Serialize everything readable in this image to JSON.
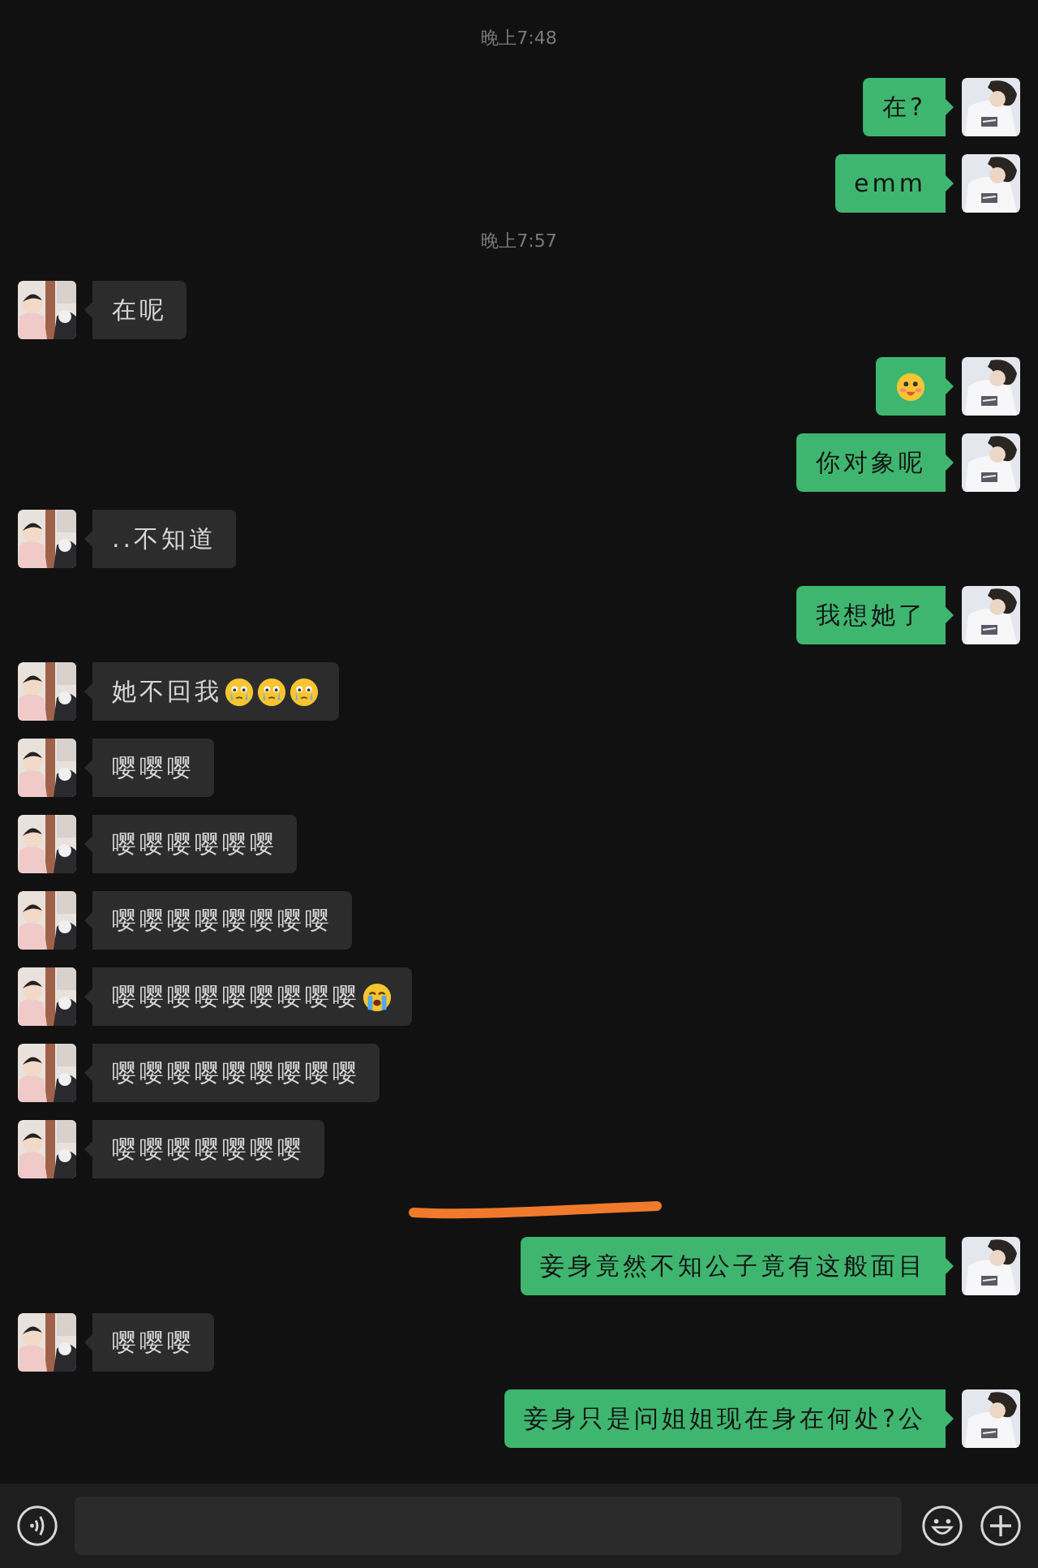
{
  "messages": [
    {
      "kind": "time",
      "text": "晚上7:48"
    },
    {
      "kind": "sent",
      "parts": [
        {
          "kind": "text",
          "text": "在?"
        }
      ]
    },
    {
      "kind": "sent",
      "parts": [
        {
          "kind": "text",
          "text": "emm"
        }
      ]
    },
    {
      "kind": "time",
      "text": "晚上7:57"
    },
    {
      "kind": "received",
      "parts": [
        {
          "kind": "text",
          "text": "在呢"
        }
      ]
    },
    {
      "kind": "sent",
      "parts": [
        {
          "kind": "blush"
        }
      ]
    },
    {
      "kind": "sent",
      "parts": [
        {
          "kind": "text",
          "text": "你对象呢"
        }
      ]
    },
    {
      "kind": "received",
      "parts": [
        {
          "kind": "text",
          "text": "..不知道"
        }
      ]
    },
    {
      "kind": "sent",
      "parts": [
        {
          "kind": "text",
          "text": "我想她了"
        }
      ]
    },
    {
      "kind": "received",
      "parts": [
        {
          "kind": "text",
          "text": "她不回我"
        },
        {
          "kind": "cry"
        },
        {
          "kind": "cry"
        },
        {
          "kind": "cry"
        }
      ]
    },
    {
      "kind": "received",
      "parts": [
        {
          "kind": "text",
          "text": "嘤嘤嘤"
        }
      ]
    },
    {
      "kind": "received",
      "parts": [
        {
          "kind": "text",
          "text": "嘤嘤嘤嘤嘤嘤"
        }
      ]
    },
    {
      "kind": "received",
      "parts": [
        {
          "kind": "text",
          "text": "嘤嘤嘤嘤嘤嘤嘤嘤"
        }
      ]
    },
    {
      "kind": "received",
      "parts": [
        {
          "kind": "text",
          "text": "嘤嘤嘤嘤嘤嘤嘤嘤嘤"
        },
        {
          "kind": "sob"
        }
      ]
    },
    {
      "kind": "received",
      "parts": [
        {
          "kind": "text",
          "text": "嘤嘤嘤嘤嘤嘤嘤嘤嘤"
        }
      ]
    },
    {
      "kind": "received",
      "parts": [
        {
          "kind": "text",
          "text": "嘤嘤嘤嘤嘤嘤嘤"
        }
      ]
    },
    {
      "kind": "scribble"
    },
    {
      "kind": "sent",
      "parts": [
        {
          "kind": "text",
          "text": "妾身竟然不知公子竟有这般面目"
        }
      ]
    },
    {
      "kind": "received",
      "parts": [
        {
          "kind": "text",
          "text": "嘤嘤嘤"
        }
      ]
    },
    {
      "kind": "sent",
      "parts": [
        {
          "kind": "text",
          "text": "妾身只是问姐姐现在身在何处?公"
        }
      ]
    }
  ]
}
